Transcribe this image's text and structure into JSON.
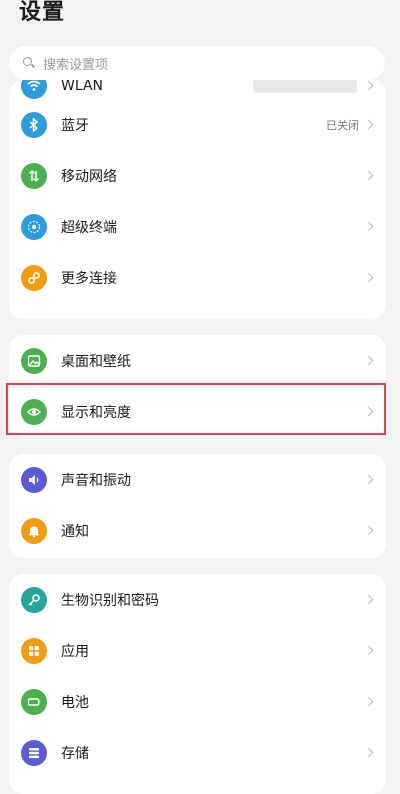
{
  "header": {
    "title": "设置"
  },
  "search": {
    "placeholder": "搜索设置项"
  },
  "group1": {
    "items": [
      {
        "label": "WLAN",
        "icon": "wifi-icon",
        "color": "#2d9cdb"
      },
      {
        "label": "蓝牙",
        "value": "已关闭",
        "icon": "bluetooth-icon",
        "color": "#2d9cdb"
      },
      {
        "label": "移动网络",
        "icon": "mobile-network-icon",
        "color": "#4caf50"
      },
      {
        "label": "超级终端",
        "icon": "super-device-icon",
        "color": "#2d9cdb"
      },
      {
        "label": "更多连接",
        "icon": "link-icon",
        "color": "#f39c12"
      }
    ]
  },
  "group2": {
    "items": [
      {
        "label": "桌面和壁纸",
        "icon": "wallpaper-icon",
        "color": "#4caf50"
      },
      {
        "label": "显示和亮度",
        "icon": "eye-icon",
        "color": "#4caf50"
      }
    ]
  },
  "group3": {
    "items": [
      {
        "label": "声音和振动",
        "icon": "speaker-icon",
        "color": "#5b5bd6"
      },
      {
        "label": "通知",
        "icon": "bell-icon",
        "color": "#f39c12"
      }
    ]
  },
  "group4": {
    "items": [
      {
        "label": "生物识别和密码",
        "icon": "key-icon",
        "color": "#26a69a"
      },
      {
        "label": "应用",
        "icon": "apps-icon",
        "color": "#f39c12"
      },
      {
        "label": "电池",
        "icon": "battery-icon",
        "color": "#4caf50"
      },
      {
        "label": "存储",
        "icon": "storage-icon",
        "color": "#5b5bd6"
      }
    ]
  },
  "colors": {
    "background": "#f1f3f5",
    "card": "#ffffff",
    "highlight": "#e5414a"
  }
}
